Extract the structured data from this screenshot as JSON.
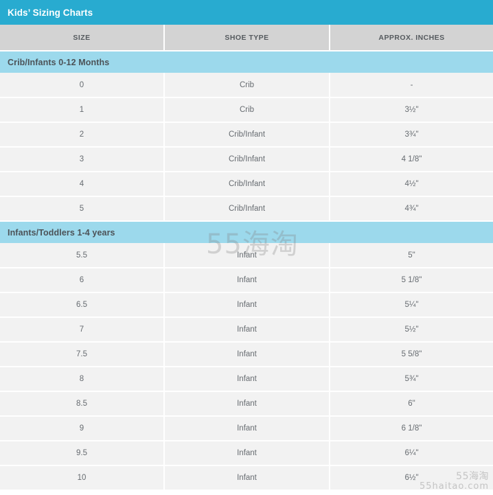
{
  "title": {
    "text": "Kids’ Sizing Charts"
  },
  "columns": [
    {
      "key": "size",
      "label": "SIZE"
    },
    {
      "key": "type",
      "label": "SHOE TYPE"
    },
    {
      "key": "inches",
      "label": "APPROX. INCHES"
    }
  ],
  "sections": [
    {
      "heading": "Crib/Infants 0-12 Months",
      "rows": [
        {
          "size": "0",
          "type": "Crib",
          "inches": "-"
        },
        {
          "size": "1",
          "type": "Crib",
          "inches": "3½\""
        },
        {
          "size": "2",
          "type": "Crib/Infant",
          "inches": "3¾\""
        },
        {
          "size": "3",
          "type": "Crib/Infant",
          "inches": "4 1/8\""
        },
        {
          "size": "4",
          "type": "Crib/Infant",
          "inches": "4½\""
        },
        {
          "size": "5",
          "type": "Crib/Infant",
          "inches": "4¾\""
        }
      ]
    },
    {
      "heading": "Infants/Toddlers 1-4 years",
      "rows": [
        {
          "size": "5.5",
          "type": "Infant",
          "inches": "5\""
        },
        {
          "size": "6",
          "type": "Infant",
          "inches": "5 1/8\""
        },
        {
          "size": "6.5",
          "type": "Infant",
          "inches": "5¼\""
        },
        {
          "size": "7",
          "type": "Infant",
          "inches": "5½\""
        },
        {
          "size": "7.5",
          "type": "Infant",
          "inches": "5 5/8\""
        },
        {
          "size": "8",
          "type": "Infant",
          "inches": "5¾\""
        },
        {
          "size": "8.5",
          "type": "Infant",
          "inches": "6\""
        },
        {
          "size": "9",
          "type": "Infant",
          "inches": "6 1/8\""
        },
        {
          "size": "9.5",
          "type": "Infant",
          "inches": "6¼\""
        },
        {
          "size": "10",
          "type": "Infant",
          "inches": "6½\""
        }
      ]
    }
  ],
  "watermarks": {
    "center": "55海淘",
    "corner_cn": "55海淘",
    "corner_url": "55haitao.com"
  },
  "colors": {
    "title_bar": "#28abd0",
    "section_header": "#9cd9ec",
    "column_header": "#d3d3d3",
    "cell_background": "#f2f2f2",
    "grid_line": "#ffffff",
    "text": "#666b70"
  }
}
